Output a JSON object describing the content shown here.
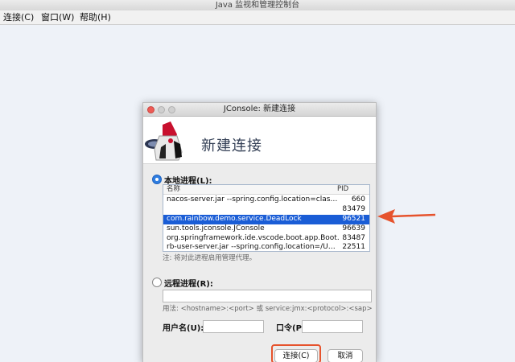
{
  "window": {
    "title": "Java 监视和管理控制台"
  },
  "menu": [
    "连接(C)",
    "窗口(W)",
    "帮助(H)"
  ],
  "dialog": {
    "title": "JConsole: 新建连接",
    "header": "新建连接",
    "local": {
      "label": "本地进程(L):",
      "selected": true,
      "columns": {
        "name": "名称",
        "pid": "PID"
      },
      "rows": [
        {
          "name": "nacos-server.jar --spring.config.location=clas…",
          "pid": "660"
        },
        {
          "name": "",
          "pid": "83479"
        },
        {
          "name": "com.rainbow.demo.service.DeadLock",
          "pid": "96521",
          "selected": true
        },
        {
          "name": "sun.tools.jconsole.JConsole",
          "pid": "96639"
        },
        {
          "name": "org.springframework.ide.vscode.boot.app.Boot…",
          "pid": "83487"
        },
        {
          "name": "rb-user-server.jar --spring.config.location=/U…",
          "pid": "22511"
        }
      ],
      "note": "注: 将对此进程启用管理代理。"
    },
    "remote": {
      "label": "远程进程(R):",
      "selected": false,
      "input_value": "",
      "usage": "用法: <hostname>:<port> 或 service:jmx:<protocol>:<sap>",
      "username_label": "用户名(U):",
      "password_label": "口令(P):"
    },
    "buttons": {
      "connect": "连接(C)",
      "cancel": "取消"
    }
  },
  "colors": {
    "selection": "#1a5dd6",
    "annotation": "#e6532d"
  }
}
